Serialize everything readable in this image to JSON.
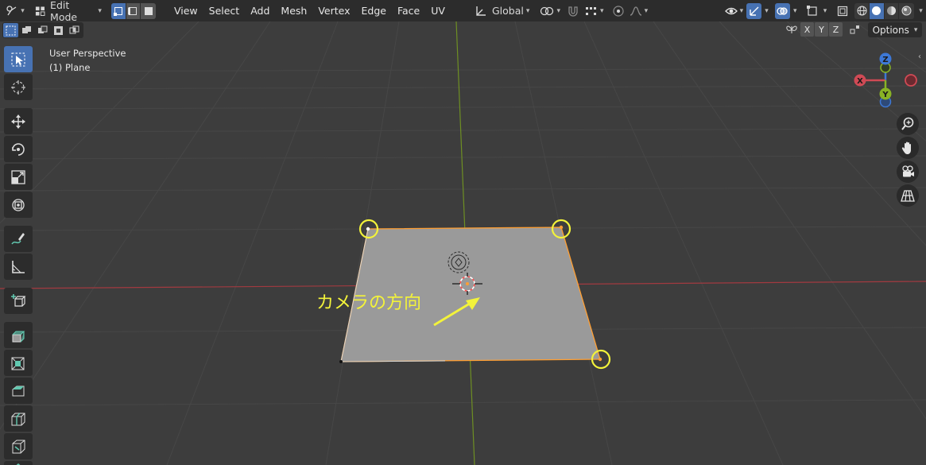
{
  "header": {
    "mode_label": "Edit Mode",
    "menus": [
      "View",
      "Select",
      "Add",
      "Mesh",
      "Vertex",
      "Edge",
      "Face",
      "UV"
    ],
    "transform_orientation": "Global"
  },
  "subrow": {
    "mirror_axes": [
      "X",
      "Y",
      "Z"
    ],
    "options_label": "Options"
  },
  "viewport": {
    "perspective_label": "User Perspective",
    "object_label": "(1) Plane",
    "annotation": "カメラの方向"
  },
  "gizmo": {
    "x_label": "X",
    "y_label": "Y",
    "z_label": "Z"
  },
  "colors": {
    "header_bg": "#2c2c2c",
    "viewport_bg": "#3d3d3d",
    "active_blue": "#4772b3",
    "annotation_yellow": "#f3f33a",
    "axis_x": "#d04a55",
    "axis_y": "#89b325",
    "axis_z": "#3d78d6",
    "selection_orange": "#ff9f33"
  }
}
